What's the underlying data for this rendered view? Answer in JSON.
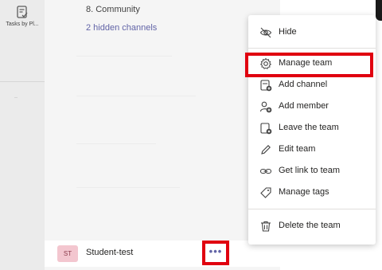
{
  "rail": {
    "app_label": "Tasks by Pl..."
  },
  "channel_list": {
    "community": "8. Community",
    "hidden_channels": "2 hidden channels"
  },
  "team_row": {
    "avatar_initials": "ST",
    "name": "Student-test",
    "more_label": "•••"
  },
  "menu": {
    "hide": "Hide",
    "manage_team": "Manage team",
    "add_channel": "Add channel",
    "add_member": "Add member",
    "leave_team": "Leave the team",
    "edit_team": "Edit team",
    "get_link": "Get link to team",
    "manage_tags": "Manage tags",
    "delete_team": "Delete the team"
  },
  "colors": {
    "accent": "#6264a7",
    "highlight_red": "#e0000f"
  }
}
